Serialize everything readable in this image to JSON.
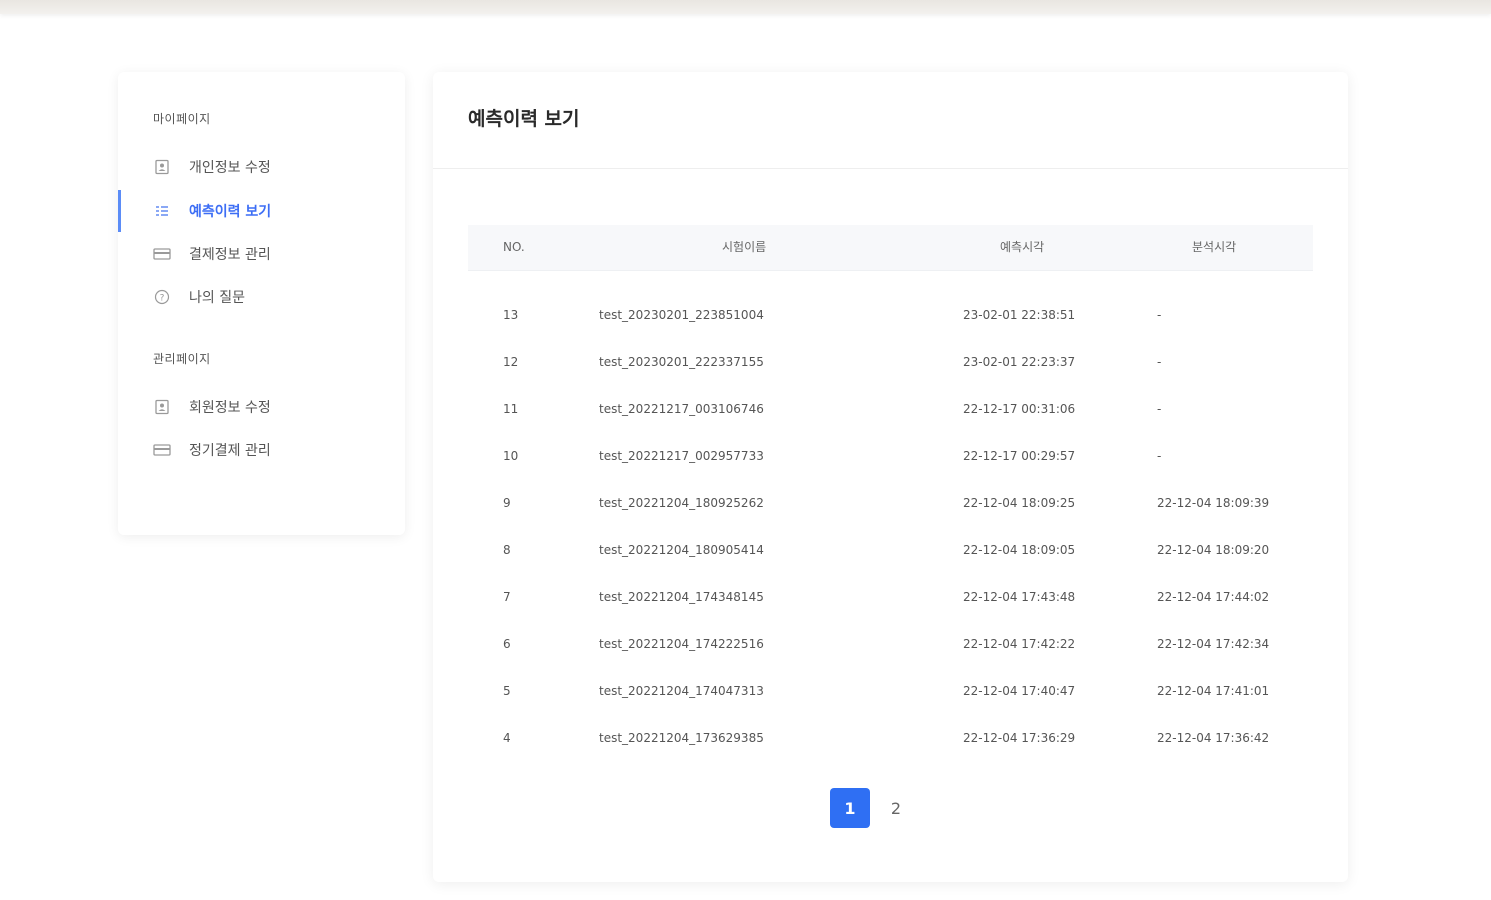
{
  "sidebar": {
    "sections": [
      {
        "title": "마이페이지",
        "items": [
          {
            "label": "개인정보 수정",
            "icon": "user-badge-icon",
            "active": false
          },
          {
            "label": "예측이력 보기",
            "icon": "list-icon",
            "active": true
          },
          {
            "label": "결제정보 관리",
            "icon": "card-icon",
            "active": false
          },
          {
            "label": "나의 질문",
            "icon": "question-icon",
            "active": false
          }
        ]
      },
      {
        "title": "관리페이지",
        "items": [
          {
            "label": "회원정보 수정",
            "icon": "user-badge-icon",
            "active": false
          },
          {
            "label": "정기결제 관리",
            "icon": "card-icon",
            "active": false
          }
        ]
      }
    ]
  },
  "panel": {
    "title": "예측이력 보기"
  },
  "table": {
    "headers": [
      "NO.",
      "시험이름",
      "예측시각",
      "분석시각"
    ],
    "rows": [
      [
        "13",
        "test_20230201_223851004",
        "23-02-01 22:38:51",
        "-"
      ],
      [
        "12",
        "test_20230201_222337155",
        "23-02-01 22:23:37",
        "-"
      ],
      [
        "11",
        "test_20221217_003106746",
        "22-12-17 00:31:06",
        "-"
      ],
      [
        "10",
        "test_20221217_002957733",
        "22-12-17 00:29:57",
        "-"
      ],
      [
        "9",
        "test_20221204_180925262",
        "22-12-04 18:09:25",
        "22-12-04 18:09:39"
      ],
      [
        "8",
        "test_20221204_180905414",
        "22-12-04 18:09:05",
        "22-12-04 18:09:20"
      ],
      [
        "7",
        "test_20221204_174348145",
        "22-12-04 17:43:48",
        "22-12-04 17:44:02"
      ],
      [
        "6",
        "test_20221204_174222516",
        "22-12-04 17:42:22",
        "22-12-04 17:42:34"
      ],
      [
        "5",
        "test_20221204_174047313",
        "22-12-04 17:40:47",
        "22-12-04 17:41:01"
      ],
      [
        "4",
        "test_20221204_173629385",
        "22-12-04 17:36:29",
        "22-12-04 17:36:42"
      ]
    ]
  },
  "pagination": {
    "pages": [
      "1",
      "2"
    ],
    "current": "1"
  },
  "colors": {
    "accent": "#2f6ff3",
    "active_text": "#3d6ef5"
  }
}
